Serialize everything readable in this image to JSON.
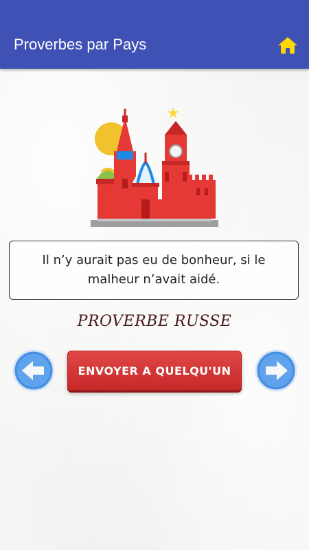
{
  "appbar": {
    "title": "Proverbes par Pays",
    "home_icon": "home-icon",
    "background_color": "#3f51b5",
    "icon_color": "#ffd600"
  },
  "illustration": {
    "icon": "kremlin-icon"
  },
  "proverb": {
    "text": "Il n’y aurait pas eu de bonheur, si le malheur n’avait aidé."
  },
  "origin": {
    "label": "PROVERBE RUSSE"
  },
  "actions": {
    "prev_icon": "arrow-left-icon",
    "next_icon": "arrow-right-icon",
    "send_label": "ENVOYER A QUELQU'UN",
    "send_color": "#d32f2f",
    "nav_color": "#4a90e2"
  }
}
